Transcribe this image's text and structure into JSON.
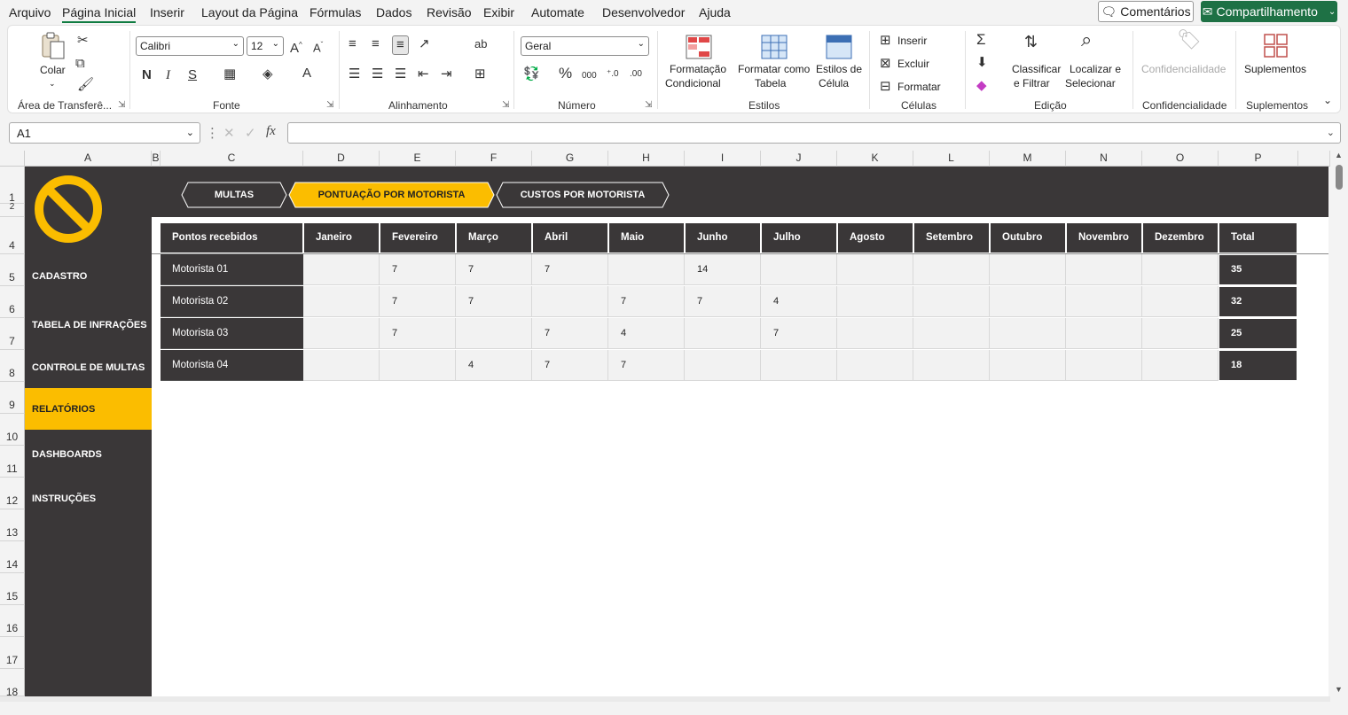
{
  "menu": {
    "items": [
      "Arquivo",
      "Página Inicial",
      "Inserir",
      "Layout da Página",
      "Fórmulas",
      "Dados",
      "Revisão",
      "Exibir",
      "Automate",
      "Desenvolvedor",
      "Ajuda"
    ],
    "comments_label": "Comentários",
    "share_label": "Compartilhamento"
  },
  "ribbon": {
    "clipboard": {
      "paste": "Colar",
      "group": "Área de Transferê..."
    },
    "font": {
      "name": "Calibri",
      "size": "12",
      "group": "Fonte",
      "bold": "N",
      "italic": "I",
      "underline": "S"
    },
    "alignment": {
      "group": "Alinhamento"
    },
    "number": {
      "format": "Geral",
      "group": "Número"
    },
    "styles": {
      "cond_format_1": "Formatação",
      "cond_format_2": "Condicional",
      "format_table_1": "Formatar como",
      "format_table_2": "Tabela",
      "cell_styles_1": "Estilos de",
      "cell_styles_2": "Célula",
      "group": "Estilos"
    },
    "cells": {
      "insert": "Inserir",
      "delete": "Excluir",
      "format": "Formatar",
      "group": "Células"
    },
    "editing": {
      "sort_1": "Classificar",
      "sort_2": "e Filtrar",
      "find_1": "Localizar e",
      "find_2": "Selecionar",
      "group": "Edição"
    },
    "sensitivity": {
      "label": "Confidencialidade",
      "group": "Confidencialidade"
    },
    "addins": {
      "label": "Suplementos",
      "group": "Suplementos"
    }
  },
  "formula_bar": {
    "cell_ref": "A1",
    "value": ""
  },
  "columns": [
    "A",
    "B",
    "C",
    "D",
    "E",
    "F",
    "G",
    "H",
    "I",
    "J",
    "K",
    "L",
    "M",
    "N",
    "O",
    "P"
  ],
  "rows": [
    "1",
    "2",
    "4",
    "5",
    "6",
    "7",
    "8",
    "9",
    "10",
    "11",
    "12",
    "13",
    "14",
    "15",
    "16",
    "17",
    "18"
  ],
  "nav": [
    "CADASTRO",
    "TABELA DE INFRAÇÕES",
    "CONTROLE DE MULTAS",
    "RELATÓRIOS",
    "DASHBOARDS",
    "INSTRUÇÕES"
  ],
  "nav_active": "RELATÓRIOS",
  "tabs": [
    "MULTAS",
    "PONTUAÇÃO POR MOTORISTA",
    "CUSTOS POR MOTORISTA"
  ],
  "tab_active": "PONTUAÇÃO POR MOTORISTA",
  "table": {
    "headers": [
      "Pontos recebidos",
      "Janeiro",
      "Fevereiro",
      "Março",
      "Abril",
      "Maio",
      "Junho",
      "Julho",
      "Agosto",
      "Setembro",
      "Outubro",
      "Novembro",
      "Dezembro",
      "Total"
    ],
    "rows": [
      {
        "name": "Motorista 01",
        "months": [
          "",
          "7",
          "7",
          "7",
          "",
          "14",
          "",
          "",
          "",
          "",
          "",
          ""
        ],
        "total": "35"
      },
      {
        "name": "Motorista 02",
        "months": [
          "",
          "7",
          "7",
          "",
          "7",
          "7",
          "4",
          "",
          "",
          "",
          "",
          ""
        ],
        "total": "32"
      },
      {
        "name": "Motorista 03",
        "months": [
          "",
          "7",
          "",
          "7",
          "4",
          "",
          "7",
          "",
          "",
          "",
          "",
          ""
        ],
        "total": "25"
      },
      {
        "name": "Motorista 04",
        "months": [
          "",
          "",
          "4",
          "7",
          "7",
          "",
          "",
          "",
          "",
          "",
          "",
          ""
        ],
        "total": "18"
      }
    ]
  },
  "colors": {
    "dark": "#3a3738",
    "accent": "#fbbd00",
    "excel_green": "#1e7145"
  },
  "icons": {
    "logo": "prohibited-sign-icon"
  }
}
